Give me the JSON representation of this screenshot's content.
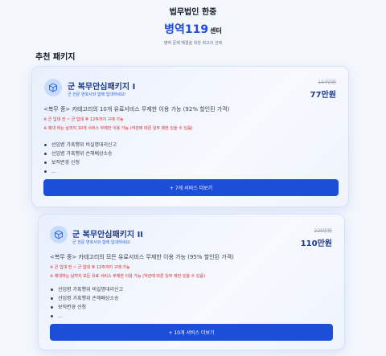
{
  "header": {
    "firm_name": "법무법인 한중",
    "brand_main": "병역119",
    "brand_suffix": "센터",
    "tagline": "병역 문제 해결을 위한 최고의 선택"
  },
  "section": {
    "title": "추천 패키지"
  },
  "packages": [
    {
      "title": "군 복무안심패키지 I",
      "subtitle": "군 전문 변호사와 함께 입대하세요!",
      "original_price": "154만원",
      "price": "77만원",
      "description": "<복무 중> 카테고리의 10개 유료서비스 무제한 이용 가능 (92% 할인된 가격)",
      "note1": "※ 군 입대 전 ~ 군 입대 후 12주까지 구매 가능",
      "note2": "※ 제대 하는 날까지 10개 서비스 무제한 이용 가능 (약관에 따른 일부 제한 있을 수 있음)",
      "services": [
        "선임병 가혹행위 비실명대리신고",
        "선임병 가혹행위 손해배상소송",
        "보직변경 신청",
        "..."
      ],
      "more_label": "+ 7개 서비스 더보기"
    },
    {
      "title": "군 복무안심패키지 II",
      "subtitle": "군 전문 변호사와 함께 입대하세요!",
      "original_price": "220만원",
      "price": "110만원",
      "description": "<복무 중> 카테고리의 모든 유료서비스 무제한 이용 가능 (95% 할인된 가격)",
      "note1": "※ 군 입대 전 ~ 군 입대 후 12주까지 구매 가능",
      "note2": "※ 제대하는 날까지 모든 유료 서비스 무제한 이용 가능 (약관에 따른 일부 제한 있을 수 있음)",
      "services": [
        "선임병 가혹행위 비실명대리신고",
        "선임병 가혹행위 손해배상소송",
        "보직변경 신청",
        "..."
      ],
      "more_label": "+ 10개 서비스 더보기"
    }
  ],
  "colors": {
    "accent": "#1d4ed8",
    "warning": "#dc2626"
  },
  "icons": {
    "package": "package-icon"
  }
}
